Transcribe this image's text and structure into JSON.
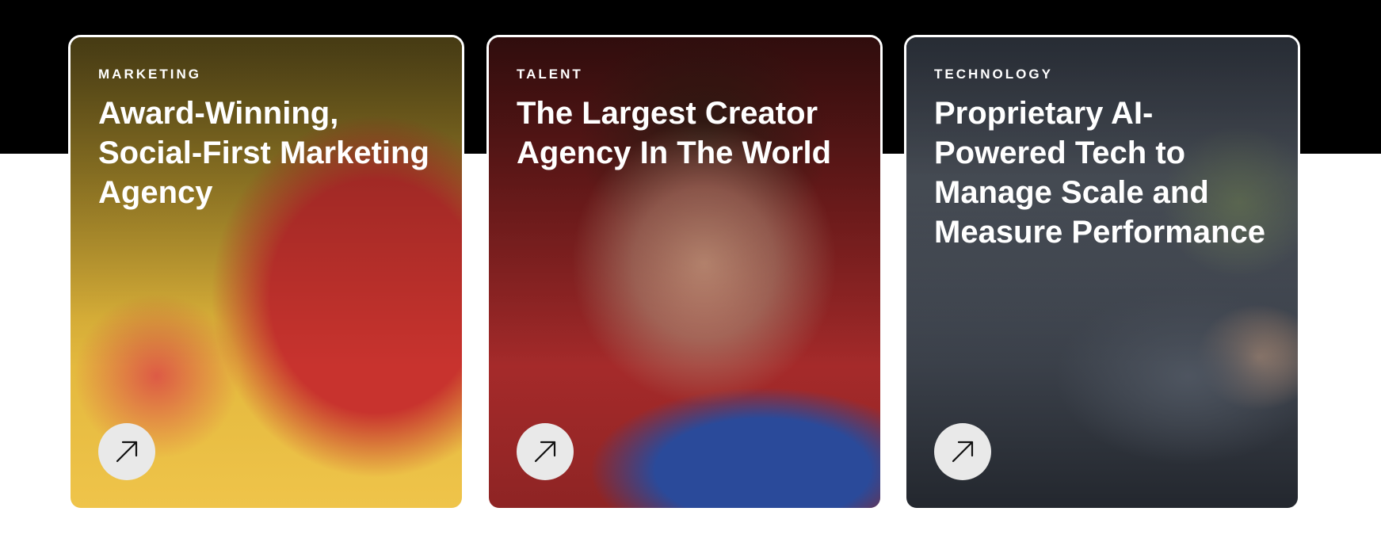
{
  "cards": [
    {
      "category": "MARKETING",
      "title": "Award-Winning, Social-First Marketing Agency",
      "arrow_icon": "arrow-up-right-icon",
      "background_colors": [
        "#e0b53a",
        "#c8332e"
      ]
    },
    {
      "category": "TALENT",
      "title": "The Largest Creator Agency In The World",
      "arrow_icon": "arrow-up-right-icon",
      "background_colors": [
        "#a52a2a",
        "#2a4a9a"
      ]
    },
    {
      "category": "TECHNOLOGY",
      "title": "Proprietary AI-Powered Tech to Manage Scale and Measure Performance",
      "arrow_icon": "arrow-up-right-icon",
      "background_colors": [
        "#555c66",
        "#23272e"
      ]
    }
  ],
  "colors": {
    "top_band": "#000000",
    "page_background": "#ffffff",
    "card_border": "#ffffff",
    "text": "#ffffff",
    "arrow_button_bg": "#e9e9e9",
    "arrow_stroke": "#111111"
  }
}
